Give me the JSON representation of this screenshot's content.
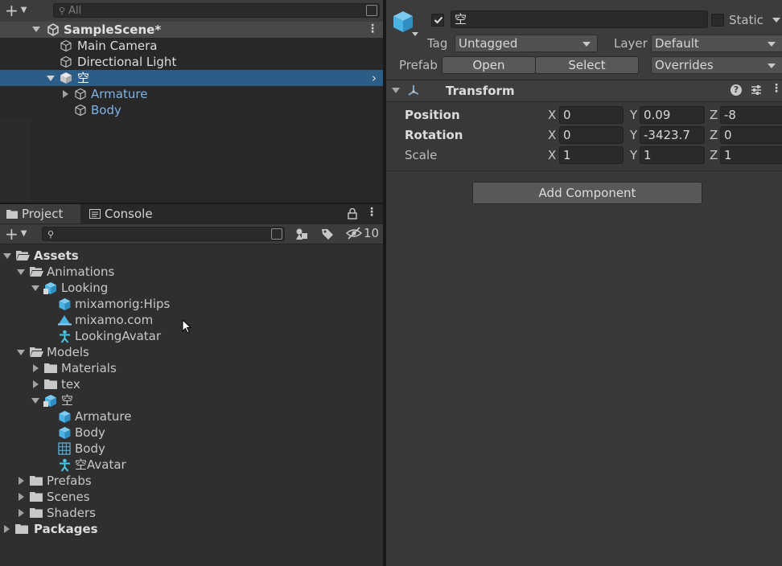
{
  "hierarchy": {
    "search_placeholder": "All",
    "scene_name": "SampleScene*",
    "items": [
      {
        "label": "Main Camera"
      },
      {
        "label": "Directional Light"
      },
      {
        "label": "空"
      },
      {
        "label": "Armature"
      },
      {
        "label": "Body"
      }
    ]
  },
  "project": {
    "tabs": [
      {
        "label": "Project"
      },
      {
        "label": "Console"
      }
    ],
    "hidden_count": "10",
    "tree": [
      {
        "label": "Assets"
      },
      {
        "label": "Animations"
      },
      {
        "label": "Looking"
      },
      {
        "label": "mixamorig:Hips"
      },
      {
        "label": "mixamo.com"
      },
      {
        "label": "LookingAvatar"
      },
      {
        "label": "Models"
      },
      {
        "label": "Materials"
      },
      {
        "label": "tex"
      },
      {
        "label": "空"
      },
      {
        "label": "Armature"
      },
      {
        "label": "Body"
      },
      {
        "label": "Body"
      },
      {
        "label": "空Avatar"
      },
      {
        "label": "Prefabs"
      },
      {
        "label": "Scenes"
      },
      {
        "label": "Shaders"
      },
      {
        "label": "Packages"
      }
    ]
  },
  "inspector": {
    "object_name": "空",
    "static_label": "Static",
    "tag_label": "Tag",
    "tag_value": "Untagged",
    "layer_label": "Layer",
    "layer_value": "Default",
    "prefab_label": "Prefab",
    "open_label": "Open",
    "select_label": "Select",
    "overrides_label": "Overrides",
    "component_title": "Transform",
    "help_icon_glyph": "?",
    "rows": [
      {
        "label": "Position",
        "x": "0",
        "y": "0.09",
        "z": "-8"
      },
      {
        "label": "Rotation",
        "x": "0",
        "y": "-3423.7",
        "z": "0"
      },
      {
        "label": "Scale",
        "x": "1",
        "y": "1",
        "z": "1"
      }
    ],
    "axis_x": "X",
    "axis_y": "Y",
    "axis_z": "Z",
    "add_component_label": "Add Component"
  },
  "colors": {
    "selection": "#2c5d87",
    "prefab_text": "#7eb4e6",
    "cube_icon": "#4bb2e6"
  }
}
